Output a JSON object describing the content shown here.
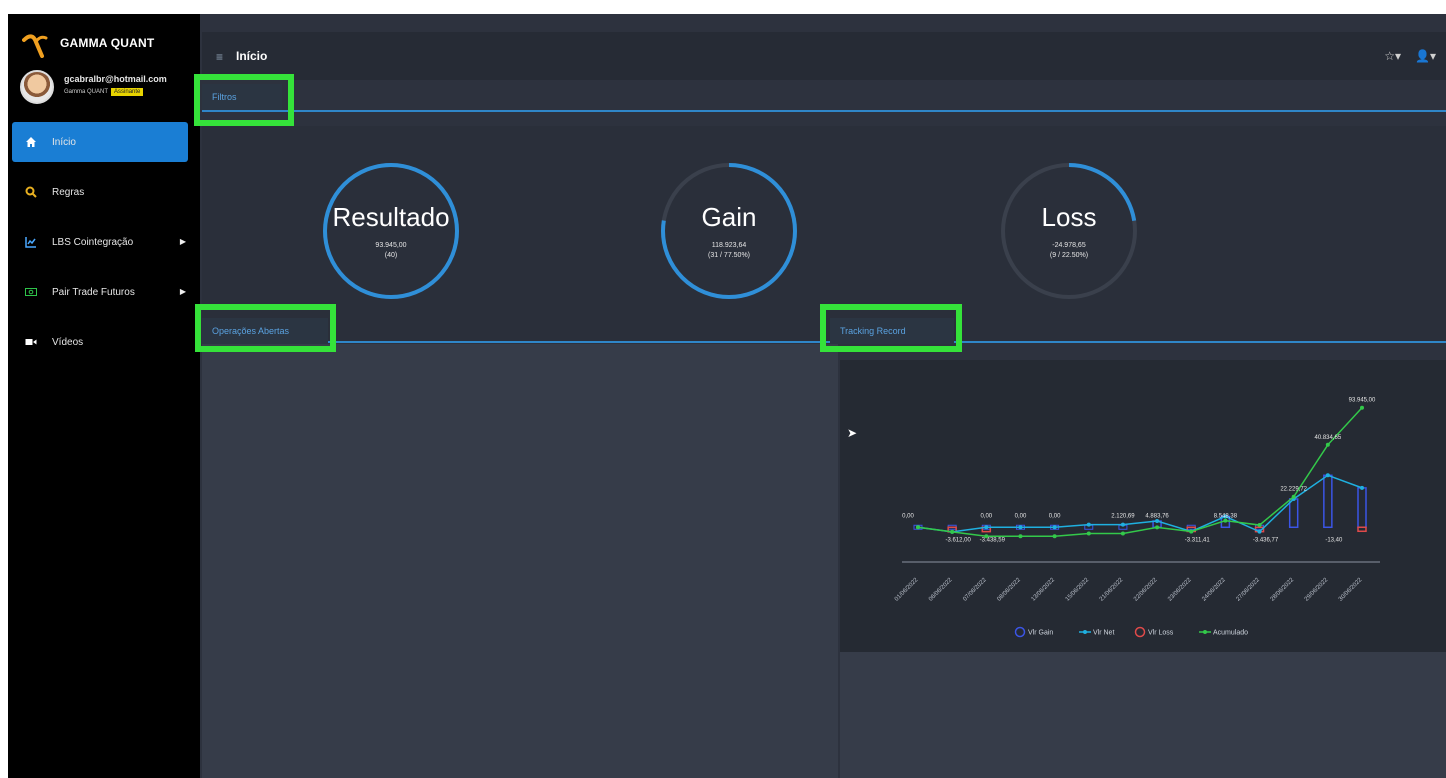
{
  "brand": {
    "name": "GAMMA QUANT"
  },
  "user": {
    "email": "gcabralbr@hotmail.com",
    "company": "Gamma QUANT",
    "badge": "Assinante"
  },
  "sidebar": {
    "items": [
      {
        "label": "Início",
        "icon": "home-icon",
        "active": true
      },
      {
        "label": "Regras",
        "icon": "search-icon",
        "active": false
      },
      {
        "label": "LBS Cointegração",
        "icon": "chart-icon",
        "active": false,
        "has_submenu": true
      },
      {
        "label": "Pair Trade Futuros",
        "icon": "money-icon",
        "active": false,
        "has_submenu": true
      },
      {
        "label": "Vídeos",
        "icon": "video-icon",
        "active": false
      }
    ]
  },
  "header": {
    "title": "Início",
    "menu_icon": "≡",
    "star_icon": "☆▾",
    "user_icon": "👤▾"
  },
  "sections": {
    "filters": "Filtros",
    "open_operations": "Operações Abertas",
    "track_record": "Tracking Record"
  },
  "gauges": [
    {
      "name": "Resultado",
      "value": "93.945,00",
      "detail": "(40)",
      "progress": 1.0
    },
    {
      "name": "Gain",
      "value": "118.923,64",
      "detail": "(31 / 77.50%)",
      "progress": 0.775
    },
    {
      "name": "Loss",
      "value": "-24.978,65",
      "detail": "(9 / 22.50%)",
      "progress": 0.225
    }
  ],
  "chart_data": {
    "type": "line",
    "categories": [
      "01/06/2022",
      "06/06/2022",
      "07/06/2022",
      "08/06/2022",
      "13/06/2022",
      "15/06/2022",
      "21/06/2022",
      "22/06/2022",
      "23/06/2022",
      "24/06/2022",
      "27/06/2022",
      "28/06/2022",
      "29/06/2022",
      "30/06/2022"
    ],
    "series": [
      {
        "name": "Vlr Gain",
        "kind": "bar",
        "color": "#3b55e6",
        "values": [
          0,
          0,
          0,
          0,
          0,
          0,
          0,
          4883.76,
          0,
          8548.38,
          0,
          22229.72,
          40834.65,
          30945.0
        ]
      },
      {
        "name": "Vlr Net",
        "kind": "line",
        "color": "#1fb0e0",
        "values": [
          0,
          -3612.0,
          0,
          0,
          0,
          2120.69,
          2120.69,
          4883.76,
          -3311.41,
          8548.38,
          -3436.77,
          22229.72,
          40834.65,
          30945.0
        ]
      },
      {
        "name": "Vlr Loss",
        "kind": "bar",
        "color": "#e04a4a",
        "values": [
          0,
          -3612.0,
          -3438.59,
          0,
          0,
          0,
          0,
          0,
          -3311.41,
          0,
          -3436.77,
          0,
          0,
          -13.4
        ]
      },
      {
        "name": "Acumulado",
        "kind": "line",
        "color": "#33c94a",
        "values": [
          0,
          -3612.0,
          -7050.59,
          -7050.59,
          -7050.59,
          -4929.9,
          -4929.9,
          -46.14,
          -3357.55,
          5190.83,
          1754.06,
          23983.78,
          64818.43,
          93945.0
        ]
      }
    ],
    "labels": [
      "0,00",
      "0,00",
      "0,00",
      "0,00",
      "2.120,69",
      "4.883,76",
      "8.548,38",
      "22.229,72",
      "40.834,65",
      "93.945,00",
      "-3.612,00",
      "-3.438,59",
      "-3.311,41",
      "-3.436,77",
      "-13,40"
    ],
    "legend_position": "bottom",
    "grid": false
  }
}
